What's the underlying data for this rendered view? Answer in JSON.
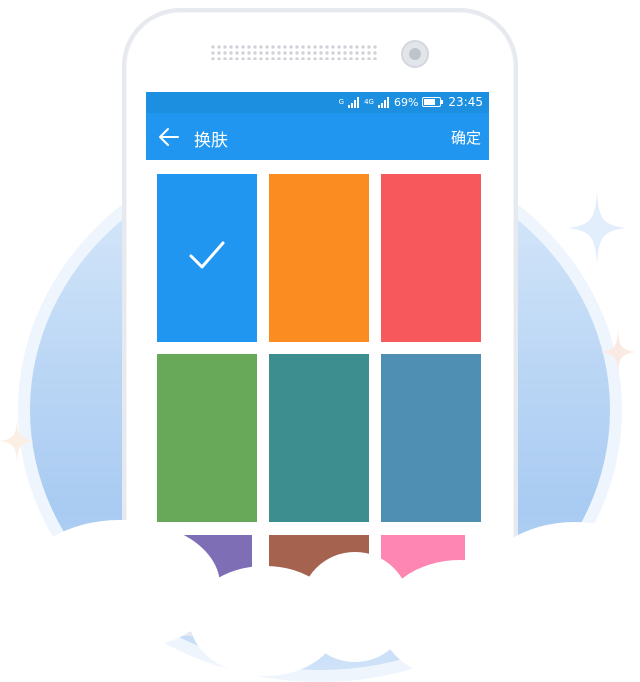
{
  "status_bar": {
    "network_1": "G",
    "network_2": "4G",
    "battery_percent": "69%",
    "time": "23:45"
  },
  "app_bar": {
    "title": "换肤",
    "confirm_label": "确定",
    "back_icon": "arrow-left-icon"
  },
  "colors": {
    "status_bar": "#1c8fe0",
    "app_bar": "#2196f0"
  },
  "skins": [
    {
      "color": "#2196f0",
      "selected": true
    },
    {
      "color": "#fb8c22",
      "selected": false
    },
    {
      "color": "#f7585b",
      "selected": false
    },
    {
      "color": "#67a958",
      "selected": false
    },
    {
      "color": "#3d8e8f",
      "selected": false
    },
    {
      "color": "#4f8fb4",
      "selected": false
    },
    {
      "color": "#7d6eb6",
      "selected": false
    },
    {
      "color": "#a5624f",
      "selected": false
    },
    {
      "color": "#fd86b2",
      "selected": false
    }
  ]
}
